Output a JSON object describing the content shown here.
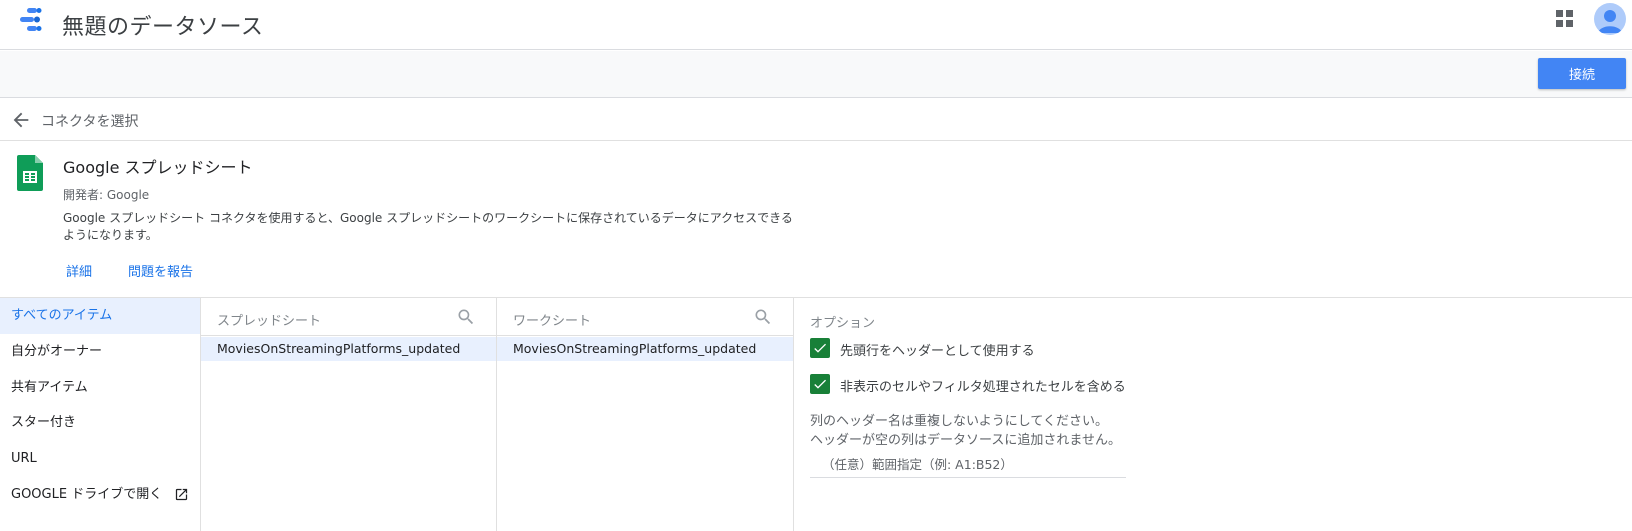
{
  "header": {
    "title": "無題のデータソース",
    "logo_icon": "data-studio-logo-icon",
    "apps_icon": "apps-grid-icon",
    "avatar_icon": "account-avatar-icon"
  },
  "toolbar": {
    "connect_label": "接続"
  },
  "back": {
    "label": "コネクタを選択"
  },
  "connector": {
    "icon": "google-sheets-icon",
    "title": "Google スプレッドシート",
    "developer": "開発者: Google",
    "description": "Google スプレッドシート コネクタを使用すると、Google スプレッドシートのワークシートに保存されているデータにアクセスできるようになります。",
    "details_link": "詳細",
    "report_link": "問題を報告"
  },
  "sidebar": {
    "items": [
      {
        "label": "すべてのアイテム",
        "active": true
      },
      {
        "label": "自分がオーナー"
      },
      {
        "label": "共有アイテム"
      },
      {
        "label": "スター付き"
      },
      {
        "label": "URL"
      },
      {
        "label": "GOOGLE ドライブで開く",
        "icon": "open-in-new-icon"
      }
    ]
  },
  "spreadsheets": {
    "header": "スプレッドシート",
    "items": [
      "MoviesOnStreamingPlatforms_updated"
    ]
  },
  "worksheets": {
    "header": "ワークシート",
    "items": [
      "MoviesOnStreamingPlatforms_updated"
    ]
  },
  "options": {
    "title": "オプション",
    "checks": [
      {
        "label": "先頭行をヘッダーとして使用する",
        "checked": true
      },
      {
        "label": "非表示のセルやフィルタ処理されたセルを含める",
        "checked": true
      }
    ],
    "note_line1": "列のヘッダー名は重複しないようにしてください。",
    "note_line2": "ヘッダーが空の列はデータソースに追加されません。",
    "range_placeholder": "（任意）範囲指定（例: A1:B52）"
  },
  "colors": {
    "accent": "#1a73e8",
    "button": "#4285f4",
    "check": "#188038",
    "selected_row": "#e8f0fe"
  }
}
